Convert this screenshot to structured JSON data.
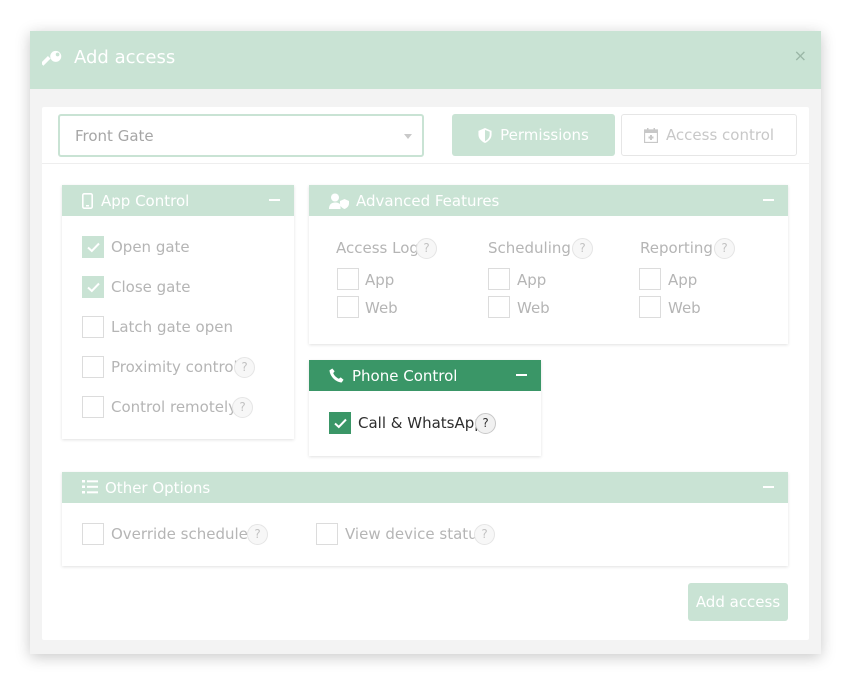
{
  "modal": {
    "title": "Add access",
    "close_label": "×",
    "icon": "key-icon"
  },
  "gate_select": {
    "value": "Front Gate"
  },
  "tabs": {
    "permissions": "Permissions",
    "access_control": "Access control"
  },
  "app_control": {
    "title": "App Control",
    "items": [
      {
        "label": "Open gate",
        "checked": true,
        "help": false
      },
      {
        "label": "Close gate",
        "checked": true,
        "help": false
      },
      {
        "label": "Latch gate open",
        "checked": false,
        "help": false
      },
      {
        "label": "Proximity control",
        "checked": false,
        "help": true
      },
      {
        "label": "Control remotely",
        "checked": false,
        "help": true
      }
    ]
  },
  "advanced_features": {
    "title": "Advanced Features",
    "groups": [
      {
        "label": "Access Log",
        "options": [
          "App",
          "Web"
        ]
      },
      {
        "label": "Scheduling",
        "options": [
          "App",
          "Web"
        ]
      },
      {
        "label": "Reporting",
        "options": [
          "App",
          "Web"
        ]
      }
    ]
  },
  "phone_control": {
    "title": "Phone Control",
    "item": {
      "label": "Call & WhatsApp",
      "checked": true
    }
  },
  "other_options": {
    "title": "Other Options",
    "items": [
      {
        "label": "Override schedules"
      },
      {
        "label": "View device status"
      }
    ]
  },
  "help_glyph": "?",
  "submit_label": "Add access",
  "colors": {
    "accent_light": "#c9e3d4",
    "accent_dark": "#3a9667"
  }
}
